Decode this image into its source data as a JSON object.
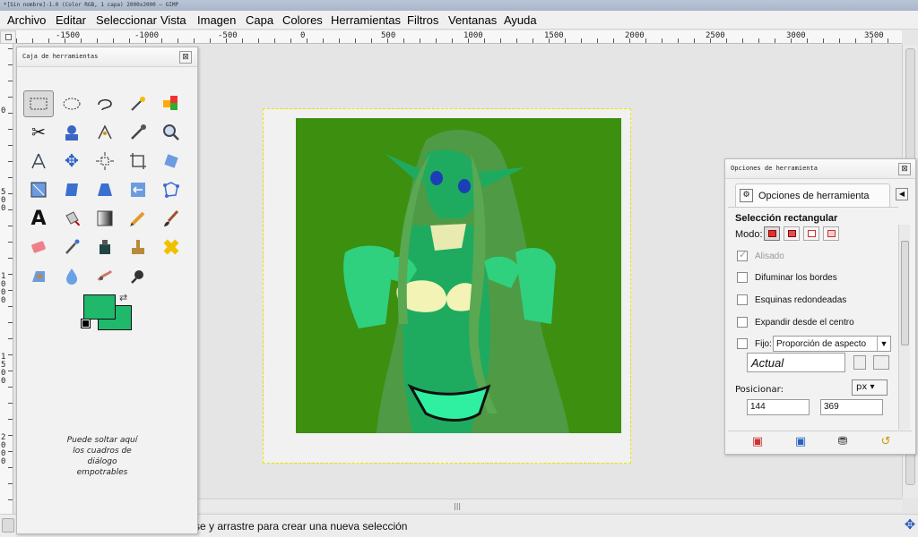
{
  "window": {
    "title": "*[Sin nombre]-1.0 (Color RGB, 1 capa) 2000x2000 – GIMP"
  },
  "menu": [
    "Archivo",
    "Editar",
    "Seleccionar",
    "Vista",
    "Imagen",
    "Capa",
    "Colores",
    "Herramientas",
    "Filtros",
    "Ventanas",
    "Ayuda"
  ],
  "ruler": {
    "h_labels": [
      "-1500",
      "-1000",
      "-500",
      "0",
      "500",
      "1000",
      "1500",
      "2000",
      "2500",
      "3000",
      "3500"
    ],
    "v_labels": [
      "0",
      "500",
      "1000",
      "1500",
      "2000"
    ]
  },
  "toolbox": {
    "title": "Caja de herramientas",
    "tools": [
      "rect-select-icon",
      "ellipse-select-icon",
      "free-select-icon",
      "fuzzy-select-icon",
      "color-select-icon",
      "scissors-select-icon",
      "foreground-select-icon",
      "paths-icon",
      "color-picker-icon",
      "zoom-icon",
      "measure-icon",
      "move-icon",
      "align-icon",
      "crop-icon",
      "rotate-icon",
      "scale-icon",
      "shear-icon",
      "perspective-icon",
      "flip-icon",
      "cage-transform-icon",
      "text-icon",
      "bucket-fill-icon",
      "blend-icon",
      "pencil-icon",
      "paintbrush-icon",
      "eraser-icon",
      "airbrush-icon",
      "ink-icon",
      "clone-icon",
      "heal-icon",
      "perspective-clone-icon",
      "blur-icon",
      "smudge-icon",
      "dodge-burn-icon"
    ],
    "fg_color": "#20b86b",
    "bg_color": "#20b86b",
    "drop_hint": "Puede soltar aquí los cuadros de diálogo empotrables"
  },
  "tool_options": {
    "title": "Opciones de herramienta",
    "tab_label": "Opciones de herramienta",
    "tool_name": "Selección rectangular",
    "mode_label": "Modo:",
    "antialias": "Alisado",
    "feather": "Difuminar los bordes",
    "rounded": "Esquinas redondeadas",
    "expand": "Expandir desde el centro",
    "fixed_label": "Fijo:",
    "fixed_value": "Proporción de aspecto",
    "aspect_value": "Actual",
    "position_label": "Posicionar:",
    "unit": "px",
    "pos_x": "144",
    "pos_y": "369"
  },
  "status": {
    "message": "se y arrastre para crear una nueva selección"
  },
  "colors": {
    "canvas_bg": "#3d8f10",
    "accent_green": "#20b86b"
  }
}
